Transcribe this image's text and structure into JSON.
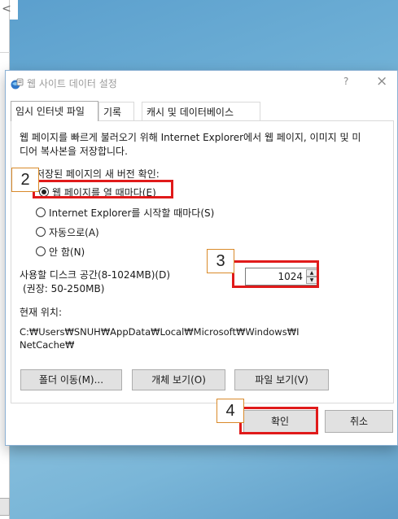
{
  "background": {
    "close_glyph": "<"
  },
  "dialog": {
    "title": "웹 사이트 데이터 설정",
    "help": "?",
    "close": "×",
    "tabs": [
      {
        "label": "임시 인터넷 파일"
      },
      {
        "label": "기록"
      },
      {
        "label": "캐시 및 데이터베이스"
      }
    ],
    "description": "웹 페이지를 빠르게 불러오기 위해 Internet Explorer에서 웹 페이지, 이미지 및 미디어 복사본을 저장합니다.",
    "check_group_label": "저장된 페이지의 새 버전 확인:",
    "radios": [
      {
        "label": "웹 페이지를 열 때마다(E)",
        "checked": true
      },
      {
        "label": "Internet Explorer를 시작할 때마다(S)",
        "checked": false
      },
      {
        "label": "자동으로(A)",
        "checked": false
      },
      {
        "label": "안 함(N)",
        "checked": false
      }
    ],
    "disk_space_label": "사용할 디스크 공간(8-1024MB)(D)",
    "disk_space_recommend": "(권장: 50-250MB)",
    "disk_space_value": "1024",
    "current_location_label": "현재 위치:",
    "current_location_path": "C:₩Users₩SNUH₩AppData₩Local₩Microsoft₩Windows₩INetCache₩",
    "buttons": {
      "move_folder": "폴더 이동(M)...",
      "view_objects": "개체 보기(O)",
      "view_files": "파일 보기(V)",
      "ok": "확인",
      "cancel": "취소"
    }
  },
  "annotations": {
    "step2": "2",
    "step3": "3",
    "step4": "4",
    "highlight_color": "#e01a1a"
  }
}
